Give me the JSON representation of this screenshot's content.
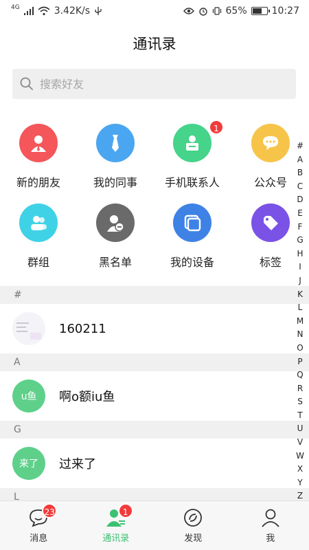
{
  "status_bar": {
    "network_type": "4G",
    "speed": "3.42K/s",
    "battery_percent": "65%",
    "time": "10:27"
  },
  "header": {
    "title": "通讯录"
  },
  "search": {
    "placeholder": "搜索好友"
  },
  "quick_grid": [
    {
      "label": "新的朋友",
      "icon": "user-icon",
      "color": "#f4565a",
      "badge": ""
    },
    {
      "label": "我的同事",
      "icon": "tie-icon",
      "color": "#4aa6f0",
      "badge": ""
    },
    {
      "label": "手机联系人",
      "icon": "contact-card-icon",
      "color": "#46d38a",
      "badge": "1"
    },
    {
      "label": "公众号",
      "icon": "chat-bubble-icon",
      "color": "#f7c44a",
      "badge": ""
    },
    {
      "label": "群组",
      "icon": "group-icon",
      "color": "#3fd2e6",
      "badge": ""
    },
    {
      "label": "黑名单",
      "icon": "block-user-icon",
      "color": "#6a6a6a",
      "badge": ""
    },
    {
      "label": "我的设备",
      "icon": "devices-icon",
      "color": "#3e82e6",
      "badge": ""
    },
    {
      "label": "标签",
      "icon": "tag-icon",
      "color": "#7a52e6",
      "badge": ""
    }
  ],
  "sections": [
    {
      "letter": "#",
      "contacts": [
        {
          "name": "160211",
          "avatar_text": ""
        }
      ]
    },
    {
      "letter": "A",
      "contacts": [
        {
          "name": "啊o额iu鱼",
          "avatar_text": "u鱼"
        }
      ]
    },
    {
      "letter": "G",
      "contacts": [
        {
          "name": "过来了",
          "avatar_text": "来了"
        }
      ]
    },
    {
      "letter": "L",
      "contacts": []
    }
  ],
  "alphabet_index": [
    "#",
    "A",
    "B",
    "C",
    "D",
    "E",
    "F",
    "G",
    "H",
    "I",
    "J",
    "K",
    "L",
    "M",
    "N",
    "O",
    "P",
    "Q",
    "R",
    "S",
    "T",
    "U",
    "V",
    "W",
    "X",
    "Y",
    "Z"
  ],
  "tab_bar": [
    {
      "label": "消息",
      "icon": "message-icon",
      "badge": "23",
      "active": false
    },
    {
      "label": "通讯录",
      "icon": "contacts-icon",
      "badge": "1",
      "active": true
    },
    {
      "label": "发现",
      "icon": "discover-icon",
      "badge": "",
      "active": false
    },
    {
      "label": "我",
      "icon": "profile-icon",
      "badge": "",
      "active": false
    }
  ],
  "colors": {
    "accent": "#3bc172",
    "badge": "#f23b3b",
    "avatar_green": "#5ed08a"
  }
}
